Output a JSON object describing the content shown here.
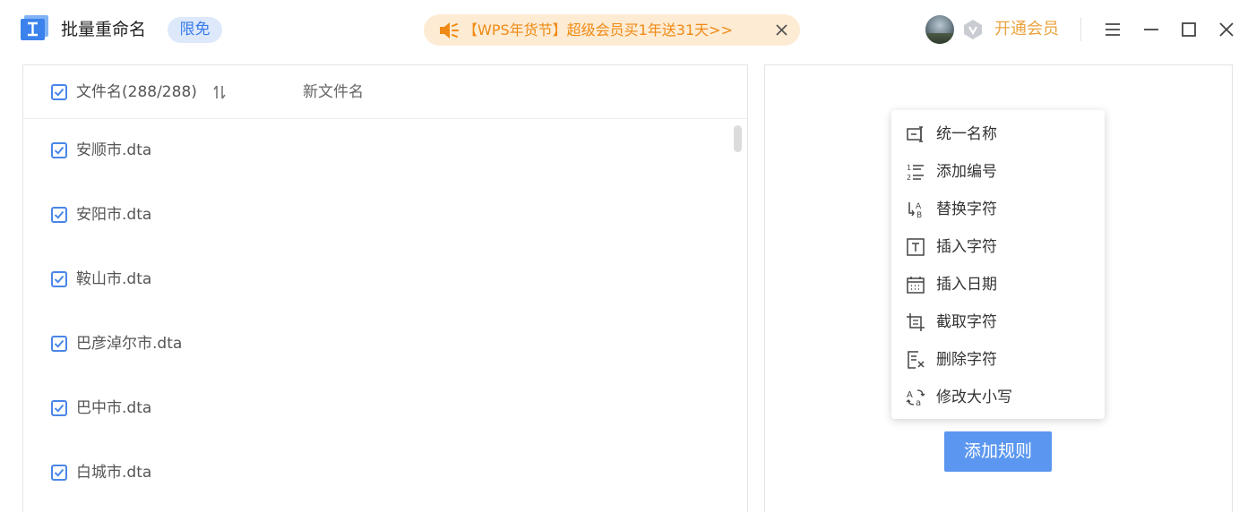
{
  "app": {
    "title": "批量重命名",
    "badge": "限免"
  },
  "promo": {
    "text": "【WPS年货节】超级会员买1年送31天>>"
  },
  "account": {
    "vip_link": "开通会员"
  },
  "file_list": {
    "header_name": "文件名(288/288)",
    "header_new_name": "新文件名",
    "rows": [
      {
        "name": "安顺市.dta",
        "checked": true
      },
      {
        "name": "安阳市.dta",
        "checked": true
      },
      {
        "name": "鞍山市.dta",
        "checked": true
      },
      {
        "name": "巴彦淖尔市.dta",
        "checked": true
      },
      {
        "name": "巴中市.dta",
        "checked": true
      },
      {
        "name": "白城市.dta",
        "checked": true
      }
    ]
  },
  "rule_menu": {
    "items": [
      {
        "label": "统一名称",
        "icon": "unify-name-icon"
      },
      {
        "label": "添加编号",
        "icon": "numbered-list-icon"
      },
      {
        "label": "替换字符",
        "icon": "replace-text-icon"
      },
      {
        "label": "插入字符",
        "icon": "text-box-icon"
      },
      {
        "label": "插入日期",
        "icon": "calendar-icon"
      },
      {
        "label": "截取字符",
        "icon": "crop-text-icon"
      },
      {
        "label": "删除字符",
        "icon": "delete-text-icon"
      },
      {
        "label": "修改大小写",
        "icon": "change-case-icon"
      }
    ]
  },
  "add_rule_button": "添加规则",
  "colors": {
    "accent": "#4a86e8",
    "button": "#5b97f0",
    "promo_text": "#ef8a14",
    "promo_bg": "#fdebd3",
    "vip": "#e9a33d",
    "badge_bg": "#dde9fb"
  }
}
